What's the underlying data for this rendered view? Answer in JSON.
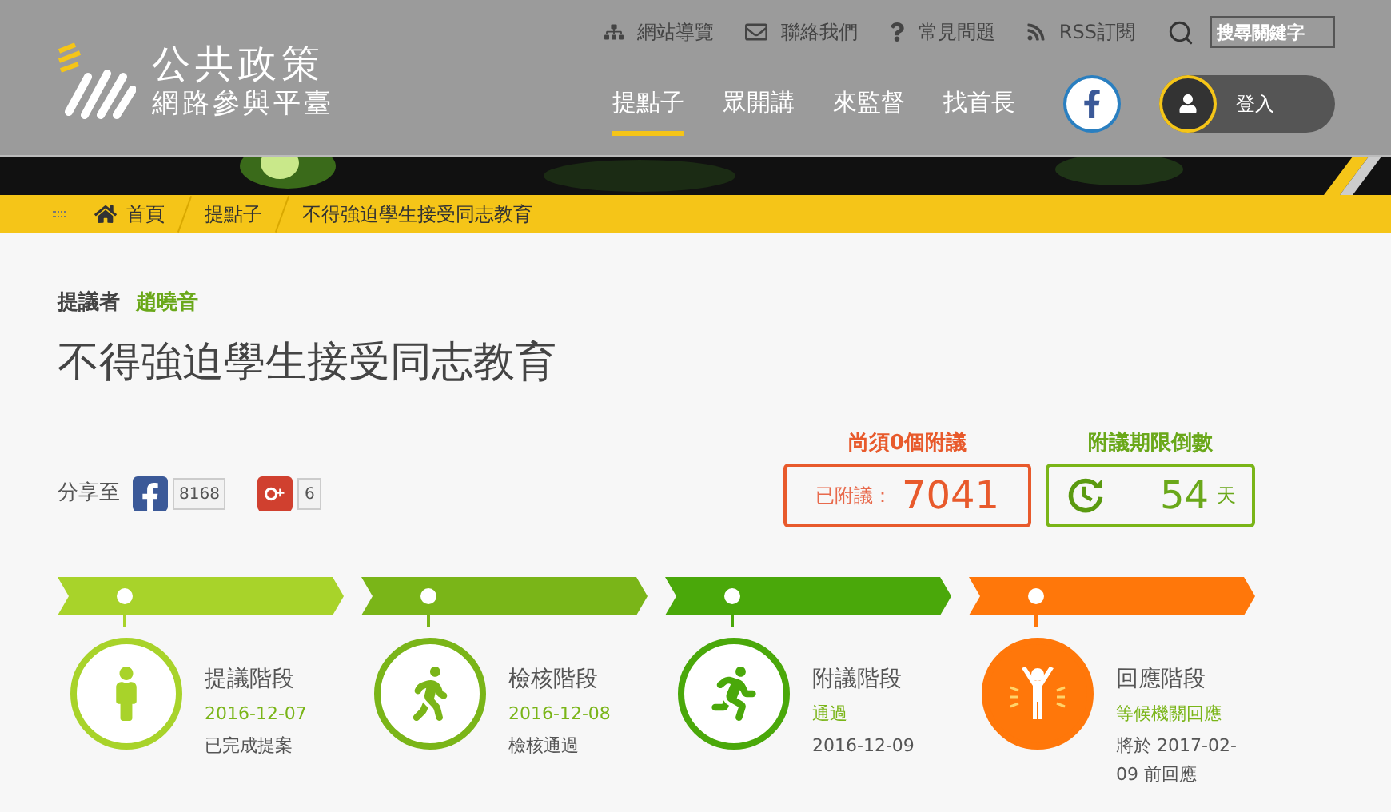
{
  "logo": {
    "title": "公共政策",
    "subtitle": "網路參與平臺"
  },
  "top_links": [
    {
      "kind": "sitemap",
      "label": "網站導覽"
    },
    {
      "kind": "mail",
      "label": "聯絡我們"
    },
    {
      "kind": "help",
      "label": "常見問題"
    },
    {
      "kind": "rss",
      "label": "RSS訂閱"
    }
  ],
  "search": {
    "placeholder": "搜尋關鍵字"
  },
  "nav": [
    {
      "label": "提點子",
      "selected": true
    },
    {
      "label": "眾開講",
      "selected": false
    },
    {
      "label": "來監督",
      "selected": false
    },
    {
      "label": "找首長",
      "selected": false
    }
  ],
  "login": {
    "label": "登入"
  },
  "breadcrumb": [
    {
      "label": "首頁",
      "kind": "home"
    },
    {
      "label": "提點子",
      "kind": "text"
    },
    {
      "label": "不得強迫學生接受同志教育",
      "kind": "text"
    }
  ],
  "proposer": {
    "label": "提議者",
    "name": "趙曉音"
  },
  "title": "不得強迫學生接受同志教育",
  "share": {
    "label": "分享至",
    "items": [
      {
        "kind": "facebook",
        "count": "8168"
      },
      {
        "kind": "google",
        "count": "6"
      }
    ]
  },
  "seconds": {
    "heading": "尚須0個附議",
    "label": "已附議：",
    "value": "7041"
  },
  "countdown": {
    "heading": "附議期限倒數",
    "value": "54",
    "unit": "天"
  },
  "stages": [
    {
      "kind": "stand",
      "color": "#a8d32a",
      "current": false,
      "title": "提議階段",
      "status": "2016-12-07",
      "note": "已完成提案"
    },
    {
      "kind": "walk",
      "color": "#7ab518",
      "current": false,
      "title": "檢核階段",
      "status": "2016-12-08",
      "note": "檢核通過"
    },
    {
      "kind": "run",
      "color": "#4aa80a",
      "current": false,
      "title": "附議階段",
      "status": "通過",
      "note": "2016-12-09"
    },
    {
      "kind": "cheer",
      "color": "#ff770a",
      "current": true,
      "title": "回應階段",
      "status": "等候機關回應",
      "note": "將於 2017-02-09 前回應"
    }
  ]
}
